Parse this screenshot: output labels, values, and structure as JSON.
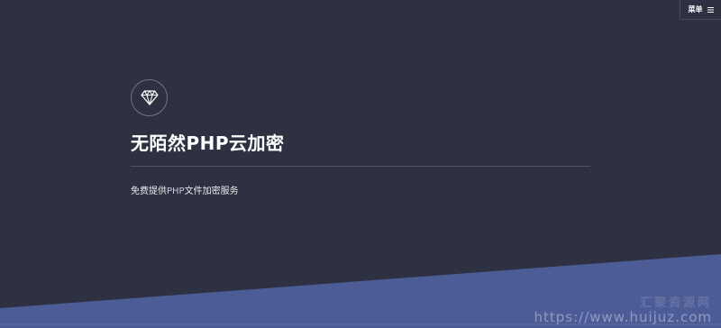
{
  "header": {
    "menu_label": "菜单",
    "menu_icon": "hamburger-icon"
  },
  "banner": {
    "logo_icon": "diamond-icon",
    "title": "无陌然PHP云加密",
    "subtitle_prefix": "免费提供",
    "subtitle_accent": "PHP",
    "subtitle_suffix": "文件加密服务"
  },
  "watermark": {
    "text_cn": "汇聚资源网",
    "url": "https://www.huijuz.com"
  },
  "colors": {
    "background": "#2e3141",
    "wave": "#4c5c96",
    "text": "#ffffff"
  }
}
